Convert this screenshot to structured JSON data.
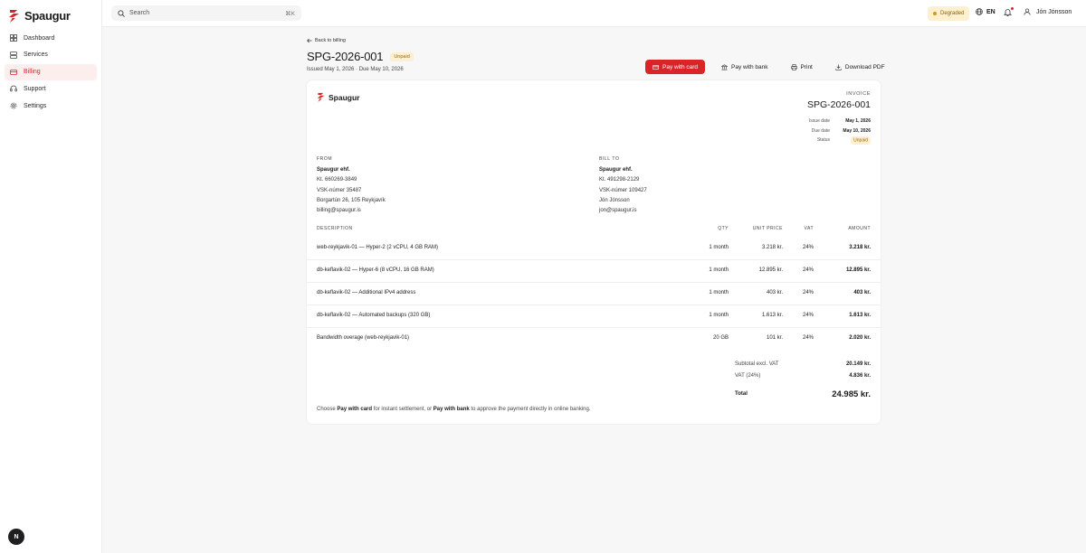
{
  "app": {
    "name": "Spaugur"
  },
  "search": {
    "placeholder": "Search",
    "shortcut": "⌘K"
  },
  "status": {
    "label": "Degraded",
    "color": "#d59a1a"
  },
  "language": "EN",
  "user": {
    "name": "Jón Jónsson"
  },
  "sidebar": {
    "items": [
      {
        "label": "Dashboard",
        "icon": "grid-icon"
      },
      {
        "label": "Services",
        "icon": "server-icon"
      },
      {
        "label": "Billing",
        "icon": "card-icon"
      },
      {
        "label": "Support",
        "icon": "headset-icon"
      },
      {
        "label": "Settings",
        "icon": "gear-icon"
      }
    ],
    "active": "Billing",
    "footer_badge": "N"
  },
  "page": {
    "back_label": "Back to billing",
    "invoice_number": "SPG-2026-001",
    "status_badge": "Unpaid",
    "issued_line": "Issued May 1, 2026 · Due May 10, 2026"
  },
  "actions": {
    "pay_card": "Pay with card",
    "pay_bank": "Pay with bank",
    "print": "Print",
    "download": "Download PDF"
  },
  "invoice": {
    "label": "INVOICE",
    "number": "SPG-2026-001",
    "meta": {
      "issue_label": "Issue date",
      "issue_value": "May 1, 2026",
      "due_label": "Due date",
      "due_value": "May 10, 2026",
      "status_label": "Status",
      "status_value": "Unpaid"
    },
    "from": {
      "label": "FROM",
      "name": "Spaugur ehf.",
      "kt": "Kt. 660269-3849",
      "vsk": "VSK-númer 35487",
      "address": "Borgartún 26, 105 Reykjavík",
      "email": "billing@spaugur.is"
    },
    "bill_to": {
      "label": "BILL TO",
      "name": "Spaugur ehf.",
      "kt": "Kt. 491298-2129",
      "vsk": "VSK-númer 109427",
      "contact": "Jón Jónsson",
      "email": "jon@spaugur.is"
    },
    "columns": {
      "description": "DESCRIPTION",
      "qty": "QTY",
      "unit_price": "UNIT PRICE",
      "vat": "VAT",
      "amount": "AMOUNT"
    },
    "items": [
      {
        "description": "web-reykjavik-01 — Hyper-2 (2 vCPU, 4 GB RAM)",
        "qty": "1 month",
        "unit_price": "3.218 kr.",
        "vat": "24%",
        "amount": "3.218 kr."
      },
      {
        "description": "db-keflavik-02 — Hyper-6 (8 vCPU, 16 GB RAM)",
        "qty": "1 month",
        "unit_price": "12.895 kr.",
        "vat": "24%",
        "amount": "12.895 kr."
      },
      {
        "description": "db-keflavik-02 — Additional IPv4 address",
        "qty": "1 month",
        "unit_price": "403 kr.",
        "vat": "24%",
        "amount": "403 kr."
      },
      {
        "description": "db-keflavik-02 — Automated backups (320 GB)",
        "qty": "1 month",
        "unit_price": "1.613 kr.",
        "vat": "24%",
        "amount": "1.613 kr."
      },
      {
        "description": "Bandwidth overage (web-reykjavik-01)",
        "qty": "20 GB",
        "unit_price": "101 kr.",
        "vat": "24%",
        "amount": "2.020 kr."
      }
    ],
    "totals": {
      "subtotal_label": "Subtotal excl. VAT",
      "subtotal_value": "20.149 kr.",
      "vat_label": "VAT (24%)",
      "vat_value": "4.836 kr.",
      "total_label": "Total",
      "total_value": "24.985 kr."
    },
    "footnote": {
      "part1": "Choose ",
      "card": "Pay with card",
      "part2": " for instant settlement, or ",
      "bank": "Pay with bank",
      "part3": " to approve the payment directly in online banking."
    }
  },
  "colors": {
    "accent": "#d9252a",
    "warning_bg": "#fcf0cf",
    "warning_text": "#a0660c"
  }
}
